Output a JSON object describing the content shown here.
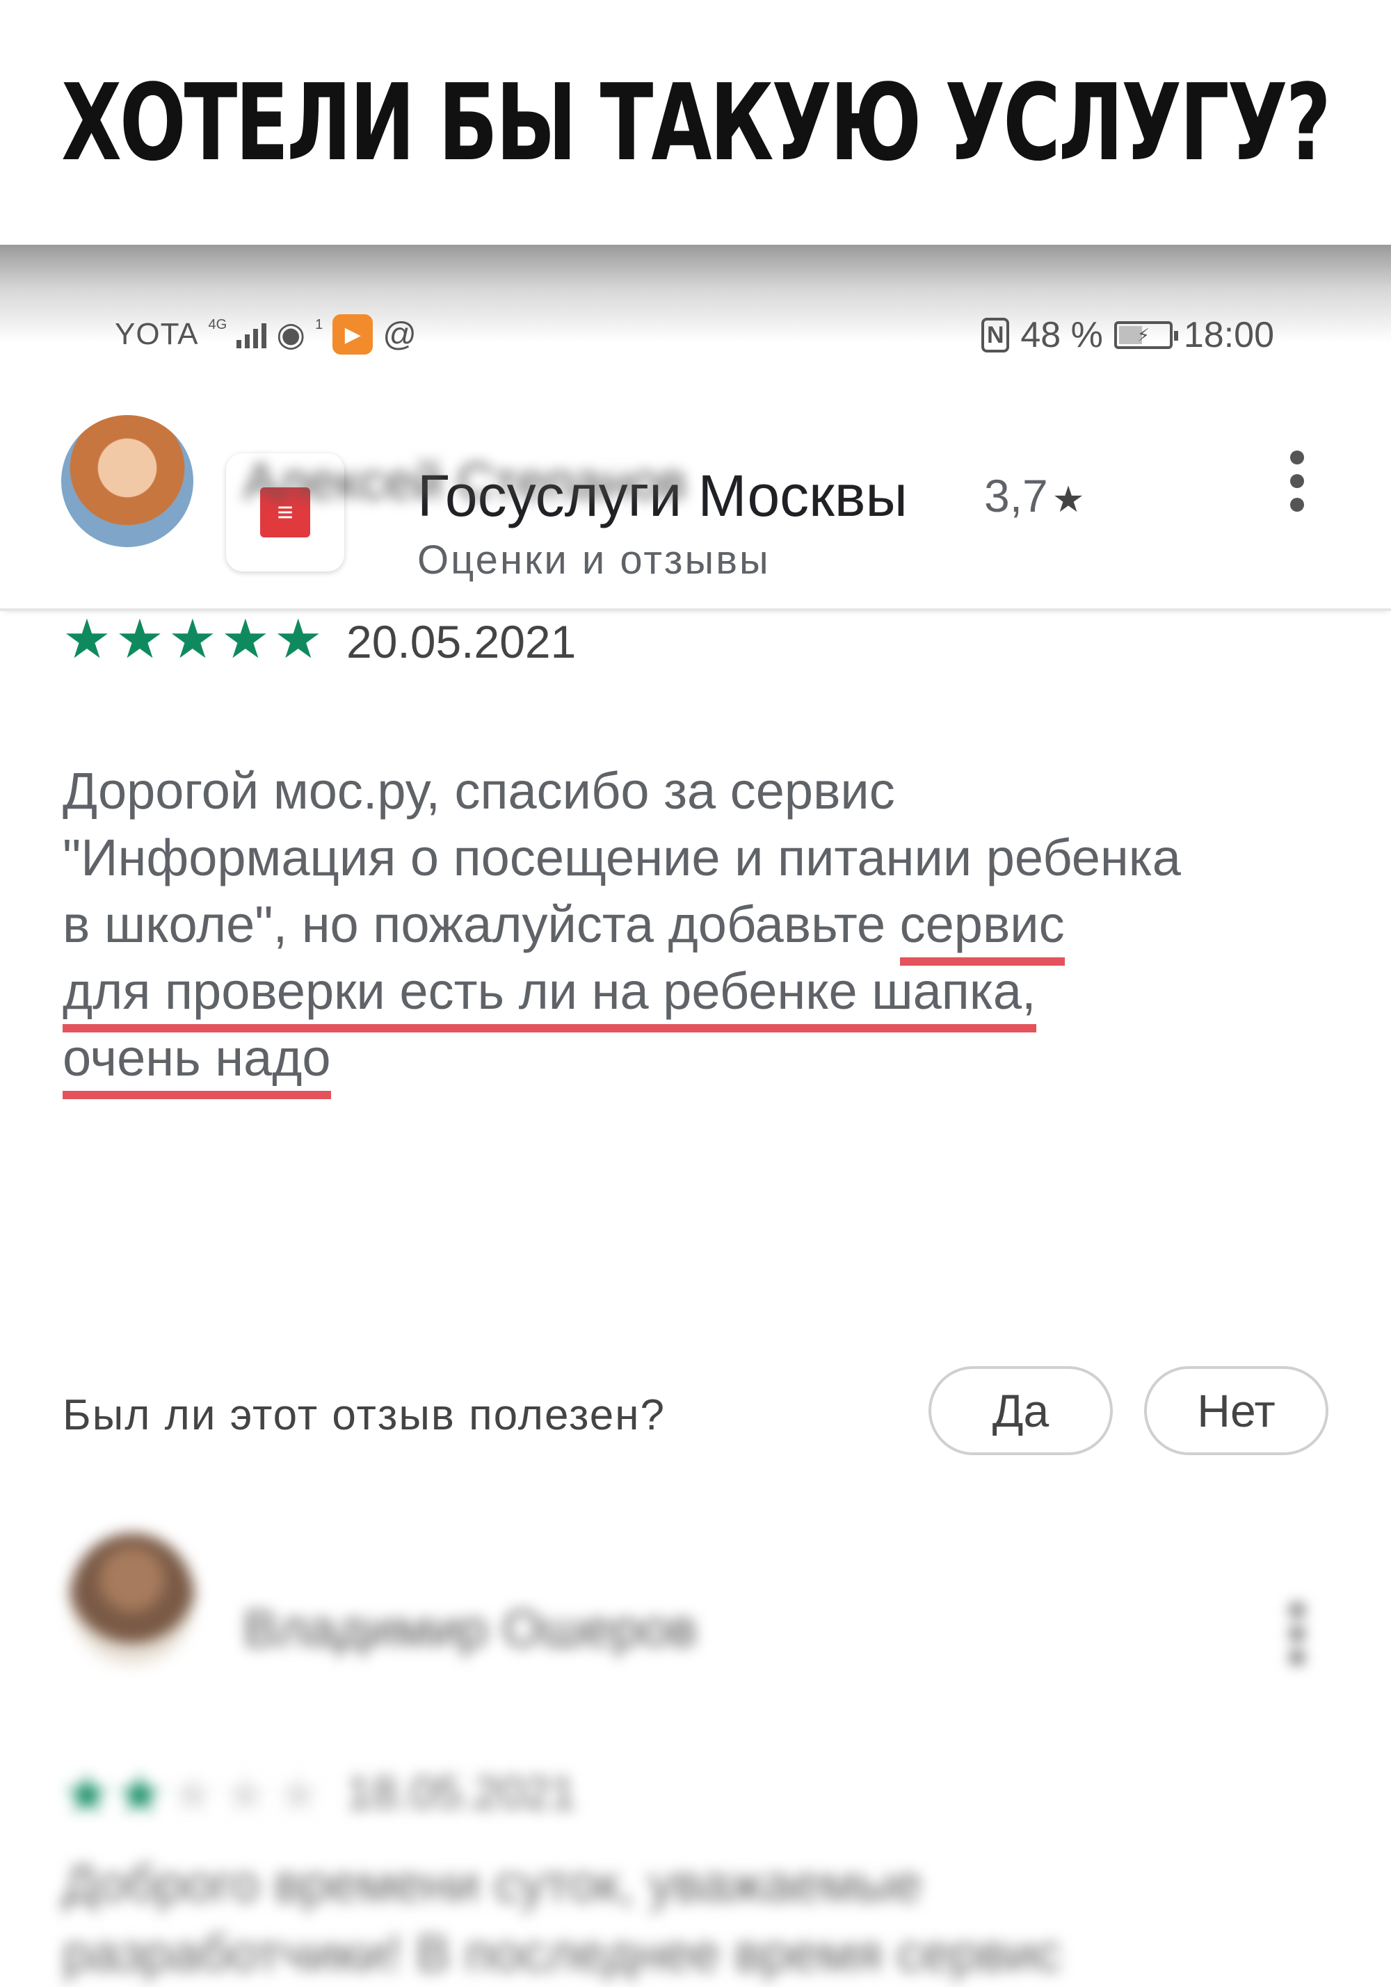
{
  "caption": "ХОТЕЛИ БЫ ТАКУЮ УСЛУГУ?",
  "status_bar": {
    "carrier": "YOTA",
    "network": "4G",
    "notification_count": "1",
    "nfc": "N",
    "battery": "48 %",
    "battery_level": 0.48,
    "time": "18:00"
  },
  "app": {
    "back_icon": "arrow-back-icon",
    "title": "Госуслуги Москвы",
    "rating": "3,7",
    "subtitle": "Оценки и отзывы"
  },
  "reviews": [
    {
      "author": "Алексей Степанов",
      "stars": 5,
      "date": "20.05.2021",
      "text_lines": [
        "Дорогой мос.ру, спасибо за сервис",
        "\"Информация о посещение и питании ребенка",
        "в школе\", но пожалуйста добавьте ",
        "сервис",
        "для проверки есть ли на ребенке шапка,",
        "очень надо"
      ],
      "helpful_question": "Был ли этот отзыв полезен?",
      "yes_label": "Да",
      "no_label": "Нет"
    },
    {
      "author": "Владимир Ошеров",
      "stars": 2,
      "date": "18.05.2021",
      "text_lines": [
        "Доброго времени суток, уважаемые",
        "разработчики! В последнее время сервис"
      ]
    }
  ],
  "colors": {
    "star_green": "#0f8a5f",
    "underline_red": "#e4535b",
    "app_icon_red": "#e03a3e"
  }
}
